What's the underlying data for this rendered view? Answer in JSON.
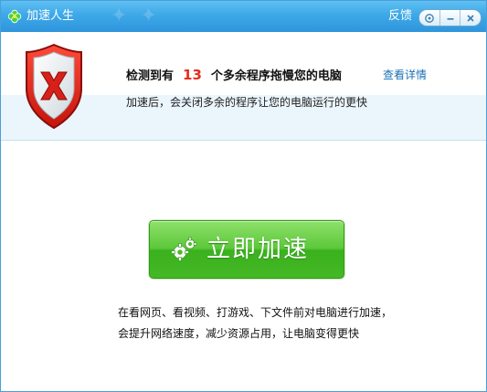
{
  "window": {
    "title": "加速人生",
    "feedback": "反馈"
  },
  "info": {
    "headline_prefix": "检测到有",
    "headline_count": "13",
    "headline_suffix": "个多余程序拖慢您的电脑",
    "details_link": "查看详情",
    "subtext": "加速后，会关闭多余的程序让您的电脑运行的更快"
  },
  "main": {
    "accelerate_button": "立即加速",
    "description_line1": "在看网页、看视频、打游戏、下文件前对电脑进行加速，",
    "description_line2": "会提升网络速度，减少资源占用，让电脑变得更快"
  },
  "colors": {
    "titlebar": "#3ea8e8",
    "count_red": "#e52b1c",
    "link_blue": "#1a6fb5",
    "button_green": "#4cbb2c"
  },
  "icons": [
    "clover-icon",
    "help-icon",
    "minimize-icon",
    "close-icon",
    "shield-x-icon",
    "gears-icon"
  ]
}
